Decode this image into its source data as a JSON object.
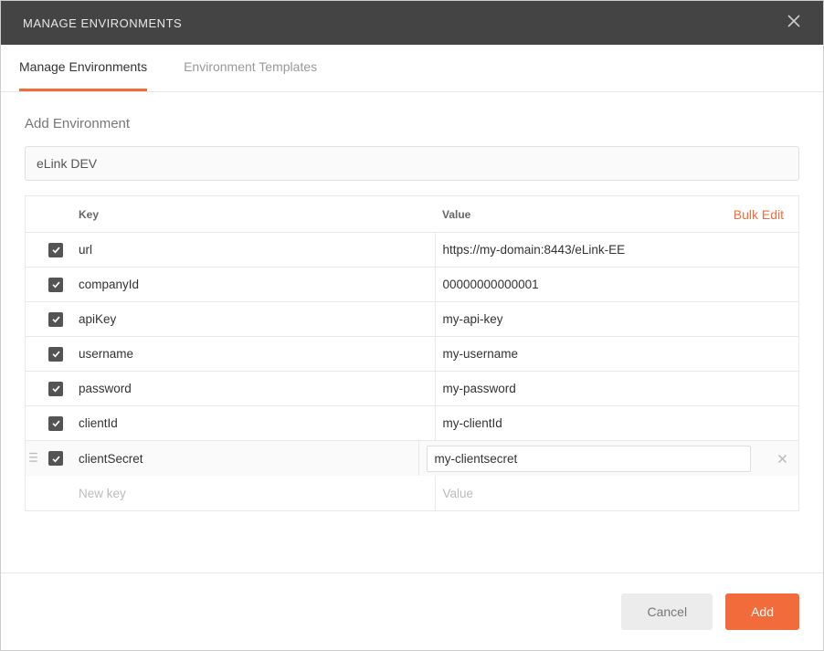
{
  "dialog": {
    "title": "MANAGE ENVIRONMENTS"
  },
  "tabs": [
    {
      "label": "Manage Environments",
      "active": true
    },
    {
      "label": "Environment Templates",
      "active": false
    }
  ],
  "section": {
    "heading": "Add Environment",
    "env_name": "eLink DEV"
  },
  "table": {
    "header_key": "Key",
    "header_value": "Value",
    "bulk_edit_label": "Bulk Edit",
    "new_key_placeholder": "New key",
    "new_value_placeholder": "Value"
  },
  "variables": [
    {
      "checked": true,
      "key": "url",
      "value": "https://my-domain:8443/eLink-EE",
      "editing": false
    },
    {
      "checked": true,
      "key": "companyId",
      "value": "00000000000001",
      "editing": false
    },
    {
      "checked": true,
      "key": "apiKey",
      "value": "my-api-key",
      "editing": false
    },
    {
      "checked": true,
      "key": "username",
      "value": "my-username",
      "editing": false
    },
    {
      "checked": true,
      "key": "password",
      "value": "my-password",
      "editing": false
    },
    {
      "checked": true,
      "key": "clientId",
      "value": "my-clientId",
      "editing": false
    },
    {
      "checked": true,
      "key": "clientSecret",
      "value": "my-clientsecret",
      "editing": true
    }
  ],
  "footer": {
    "cancel_label": "Cancel",
    "add_label": "Add"
  },
  "colors": {
    "accent": "#F26B3A",
    "titlebar": "#444444"
  }
}
